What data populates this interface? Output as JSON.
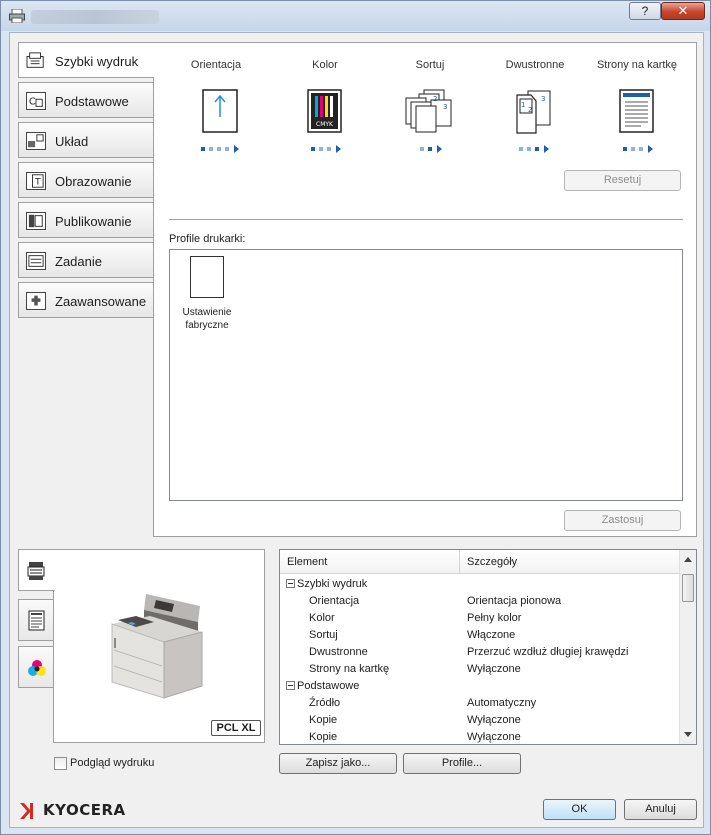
{
  "window": {
    "help_label": "?",
    "close_label": "✕"
  },
  "tabs": [
    {
      "label": "Szybki wydruk",
      "icon": "quick-print-icon"
    },
    {
      "label": "Podstawowe",
      "icon": "basic-icon"
    },
    {
      "label": "Układ",
      "icon": "layout-icon"
    },
    {
      "label": "Obrazowanie",
      "icon": "imaging-icon"
    },
    {
      "label": "Publikowanie",
      "icon": "publishing-icon"
    },
    {
      "label": "Zadanie",
      "icon": "job-icon"
    },
    {
      "label": "Zaawansowane",
      "icon": "advanced-icon"
    }
  ],
  "quick_print": {
    "features": [
      {
        "label": "Orientacja",
        "icon": "orientation-portrait-icon"
      },
      {
        "label": "Kolor",
        "icon": "color-cmyk-icon",
        "cmyk": "CMYK"
      },
      {
        "label": "Sortuj",
        "icon": "collate-icon"
      },
      {
        "label": "Dwustronne",
        "icon": "duplex-icon"
      },
      {
        "label": "Strony na kartkę",
        "icon": "pages-per-sheet-icon"
      }
    ],
    "reset_label": "Resetuj",
    "profiles_label": "Profile drukarki:",
    "profile_item_label": "Ustawienie fabryczne",
    "apply_label": "Zastosuj"
  },
  "preview": {
    "badge": "PCL XL",
    "print_preview_label": "Podgląd wydruku"
  },
  "details_table": {
    "headers": [
      "Element",
      "Szczegóły"
    ],
    "rows": [
      {
        "group": true,
        "element": "Szybki wydruk",
        "details": ""
      },
      {
        "group": false,
        "element": "Orientacja",
        "details": "Orientacja pionowa"
      },
      {
        "group": false,
        "element": "Kolor",
        "details": "Pełny kolor"
      },
      {
        "group": false,
        "element": "Sortuj",
        "details": "Włączone"
      },
      {
        "group": false,
        "element": "Dwustronne",
        "details": "Przerzuć wzdłuż długiej krawędzi"
      },
      {
        "group": false,
        "element": "Strony na kartkę",
        "details": "Wyłączone"
      },
      {
        "group": true,
        "element": "Podstawowe",
        "details": ""
      },
      {
        "group": false,
        "element": "Źródło",
        "details": "Automatyczny"
      },
      {
        "group": false,
        "element": "Kopie",
        "details": "Wyłączone"
      },
      {
        "group": false,
        "element": "Kopie",
        "details": "Wyłączone"
      }
    ]
  },
  "buttons": {
    "save_as": "Zapisz jako...",
    "profiles": "Profile...",
    "ok": "OK",
    "cancel": "Anuluj"
  },
  "brand": {
    "name": "KYOCERA",
    "color": "#d52b1e"
  },
  "colors": {
    "accent": "#1f5fa8",
    "window_frame": "#dbe5f1"
  }
}
